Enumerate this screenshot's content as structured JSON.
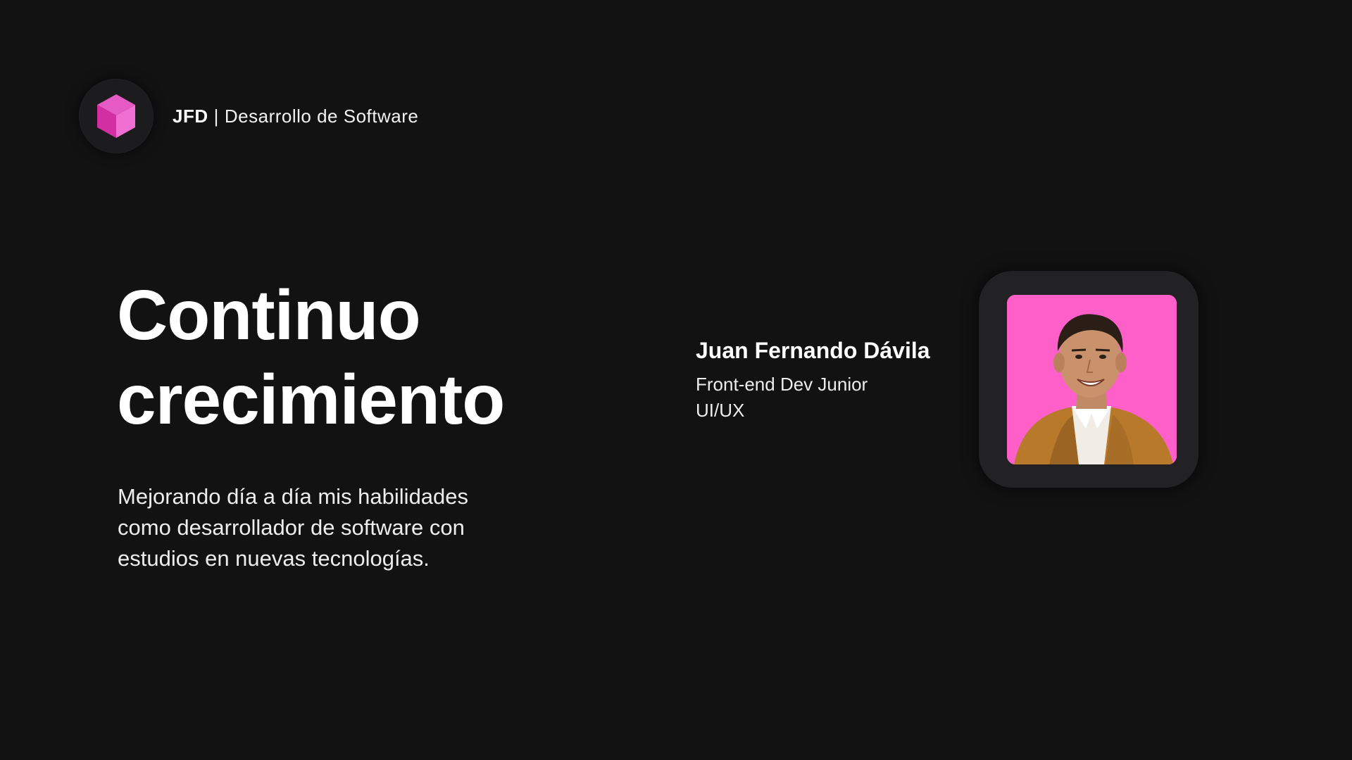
{
  "header": {
    "brand_strong": "JFD",
    "brand_separator": "|",
    "brand_rest": "Desarrollo de Software",
    "logo_icon": "cube-icon",
    "logo_colors": {
      "top": "#e84fc0",
      "left": "#d0309f",
      "right": "#f06ad0"
    }
  },
  "hero": {
    "title_line1": "Continuo",
    "title_line2": "crecimiento",
    "description": "Mejorando día a día mis habilidades como desarrollador de software con estudios en nuevas tecnologías."
  },
  "profile": {
    "name": "Juan Fernando Dávila",
    "role_line1": "Front-end Dev Junior",
    "role_line2": "UI/UX",
    "photo_background": "#ff5fc8"
  },
  "colors": {
    "background": "#121212",
    "card": "#222224",
    "accent": "#ff5fc8"
  }
}
